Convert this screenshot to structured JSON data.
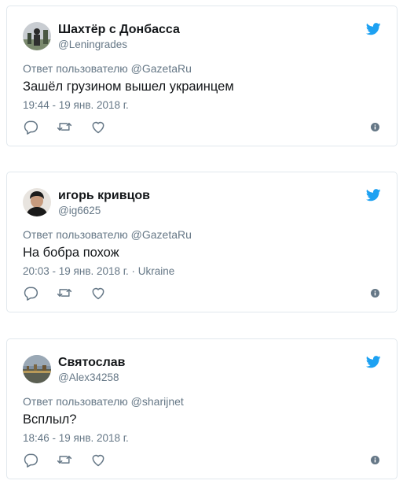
{
  "tweets": [
    {
      "name": "Шахтёр с Донбасса",
      "handle": "@Leningrades",
      "reply_prefix": "Ответ пользователю",
      "reply_to": "@GazetaRu",
      "text": "Зашёл грузином вышел украинцем",
      "timestamp": "19:44 - 19 янв. 2018 г.",
      "location": ""
    },
    {
      "name": "игорь кривцов",
      "handle": "@ig6625",
      "reply_prefix": "Ответ пользователю",
      "reply_to": "@GazetaRu",
      "text": "На бобра похож",
      "timestamp": "20:03 - 19 янв. 2018 г.",
      "location": " · Ukraine"
    },
    {
      "name": "Святослав",
      "handle": "@Alex34258",
      "reply_prefix": "Ответ пользователю",
      "reply_to": "@sharijnet",
      "text": "Всплыл?",
      "timestamp": "18:46 - 19 янв. 2018 г.",
      "location": ""
    }
  ],
  "colors": {
    "twitter_blue": "#1da1f2",
    "muted": "#657786",
    "text": "#14171a",
    "border": "#e1e8ed"
  },
  "icons": [
    "twitter-bird-icon",
    "reply-icon",
    "retweet-icon",
    "like-icon",
    "info-icon"
  ]
}
